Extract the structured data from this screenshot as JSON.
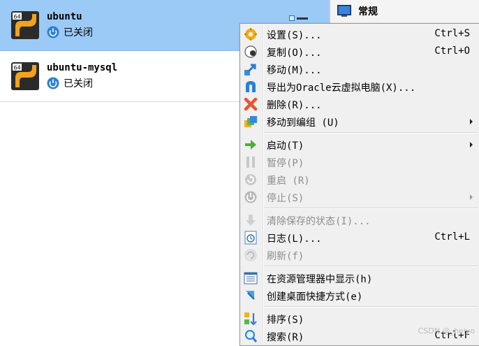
{
  "vms": [
    {
      "name": "ubuntu",
      "status": "已关闭",
      "badge": "64"
    },
    {
      "name": "ubuntu-mysql",
      "status": "已关闭",
      "badge": "64"
    }
  ],
  "details": {
    "title": "常规"
  },
  "menu": {
    "settings": {
      "label": "设置(S)...",
      "shortcut": "Ctrl+S"
    },
    "clone": {
      "label": "复制(O)...",
      "shortcut": "Ctrl+O"
    },
    "move": {
      "label": "移动(M)..."
    },
    "export": {
      "label": "导出为Oracle云虚拟电脑(X)..."
    },
    "remove": {
      "label": "删除(R)..."
    },
    "move_group": {
      "label": "移动到编组 (U)"
    },
    "start": {
      "label": "启动(T)"
    },
    "pause": {
      "label": "暂停(P)"
    },
    "reset": {
      "label": "重启 (R)"
    },
    "stop": {
      "label": "停止(S)"
    },
    "discard": {
      "label": "清除保存的状态(I)..."
    },
    "log": {
      "label": "日志(L)...",
      "shortcut": "Ctrl+L"
    },
    "refresh": {
      "label": "刷新(f)"
    },
    "show_explorer": {
      "label": "在资源管理器中显示(h)"
    },
    "shortcut_desktop": {
      "label": "创建桌面快捷方式(e)"
    },
    "sort": {
      "label": "排序(S)"
    },
    "search": {
      "label": "搜索(R)",
      "shortcut": "Ctrl+F"
    }
  },
  "watermark": "CSDN @_heiyo",
  "colors": {
    "selection": "#9ccaf7",
    "menu_bg": "#f0f0f0"
  }
}
